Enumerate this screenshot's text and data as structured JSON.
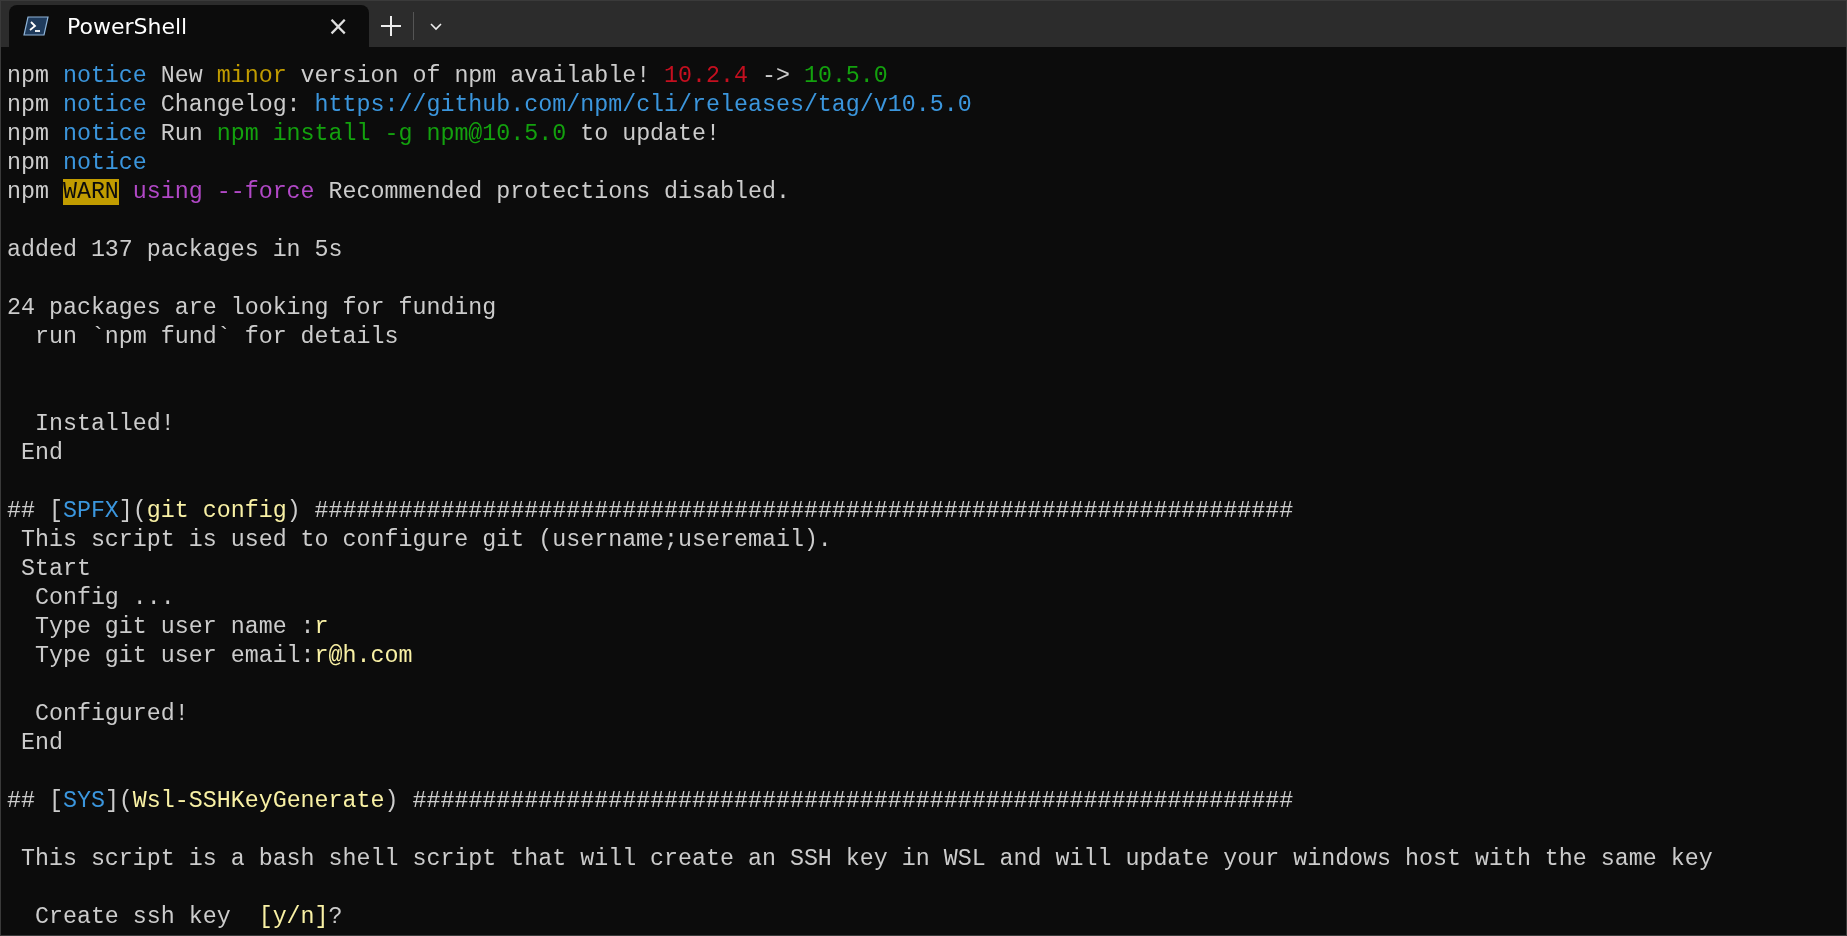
{
  "tab": {
    "title": "PowerShell",
    "selected": true
  },
  "lines": [
    {
      "kind": "text",
      "segments": [
        {
          "text": "npm ",
          "color": "#cccccc"
        },
        {
          "text": "notice",
          "color": "#3b96dd"
        },
        {
          "text": " New ",
          "color": "#cccccc"
        },
        {
          "text": "minor",
          "color": "#c19c00"
        },
        {
          "text": " version of npm available! ",
          "color": "#cccccc"
        },
        {
          "text": "10.2.4",
          "color": "#c50f1f"
        },
        {
          "text": " -> ",
          "color": "#cccccc"
        },
        {
          "text": "10.5.0",
          "color": "#13a10e"
        }
      ]
    },
    {
      "kind": "text",
      "segments": [
        {
          "text": "npm ",
          "color": "#cccccc"
        },
        {
          "text": "notice",
          "color": "#3b96dd"
        },
        {
          "text": " Changelog: ",
          "color": "#cccccc"
        },
        {
          "text": "https://github.com/npm/cli/releases/tag/v10.5.0",
          "color": "#3b96dd"
        }
      ]
    },
    {
      "kind": "text",
      "segments": [
        {
          "text": "npm ",
          "color": "#cccccc"
        },
        {
          "text": "notice",
          "color": "#3b96dd"
        },
        {
          "text": " Run ",
          "color": "#cccccc"
        },
        {
          "text": "npm install -g npm@10.5.0",
          "color": "#13a10e"
        },
        {
          "text": " to update!",
          "color": "#cccccc"
        }
      ]
    },
    {
      "kind": "text",
      "segments": [
        {
          "text": "npm ",
          "color": "#cccccc"
        },
        {
          "text": "notice",
          "color": "#3b96dd"
        }
      ]
    },
    {
      "kind": "text",
      "segments": [
        {
          "text": "npm ",
          "color": "#cccccc"
        },
        {
          "text": "WARN",
          "color": "#c19c00",
          "kind": "badge"
        },
        {
          "text": " using --force",
          "color": "#b148c6"
        },
        {
          "text": " Recommended protections disabled.",
          "color": "#cccccc"
        }
      ]
    },
    {
      "kind": "blank"
    },
    {
      "kind": "text",
      "segments": [
        {
          "text": "added 137 packages in 5s",
          "color": "#cccccc"
        }
      ]
    },
    {
      "kind": "blank"
    },
    {
      "kind": "text",
      "segments": [
        {
          "text": "24 packages are looking for funding",
          "color": "#cccccc"
        }
      ]
    },
    {
      "kind": "text",
      "segments": [
        {
          "text": "  run `npm fund` for details",
          "color": "#cccccc"
        }
      ]
    },
    {
      "kind": "blank"
    },
    {
      "kind": "blank"
    },
    {
      "kind": "text",
      "segments": [
        {
          "text": "  Installed!",
          "color": "#cccccc"
        }
      ]
    },
    {
      "kind": "text",
      "segments": [
        {
          "text": " End",
          "color": "#cccccc"
        }
      ]
    },
    {
      "kind": "blank"
    },
    {
      "kind": "text",
      "segments": [
        {
          "text": "## [",
          "color": "#cccccc"
        },
        {
          "text": "SPFX",
          "color": "#3b96dd"
        },
        {
          "text": "](",
          "color": "#cccccc"
        },
        {
          "text": "git config",
          "color": "#f9f1a5"
        },
        {
          "text": ") ######################################################################",
          "color": "#cccccc"
        }
      ]
    },
    {
      "kind": "text",
      "segments": [
        {
          "text": " This script is used to configure git (username;useremail).",
          "color": "#cccccc"
        }
      ]
    },
    {
      "kind": "text",
      "segments": [
        {
          "text": " Start",
          "color": "#cccccc"
        }
      ]
    },
    {
      "kind": "text",
      "segments": [
        {
          "text": "  Config ...",
          "color": "#cccccc"
        }
      ]
    },
    {
      "kind": "text",
      "segments": [
        {
          "text": "  Type git user name :",
          "color": "#cccccc"
        },
        {
          "text": "r",
          "color": "#f9f1a5"
        }
      ]
    },
    {
      "kind": "text",
      "segments": [
        {
          "text": "  Type git user email:",
          "color": "#cccccc"
        },
        {
          "text": "r@h.com",
          "color": "#f9f1a5"
        }
      ]
    },
    {
      "kind": "blank"
    },
    {
      "kind": "text",
      "segments": [
        {
          "text": "  Configured!",
          "color": "#cccccc"
        }
      ]
    },
    {
      "kind": "text",
      "segments": [
        {
          "text": " End",
          "color": "#cccccc"
        }
      ]
    },
    {
      "kind": "blank"
    },
    {
      "kind": "text",
      "segments": [
        {
          "text": "## [",
          "color": "#cccccc"
        },
        {
          "text": "SYS",
          "color": "#3b96dd"
        },
        {
          "text": "](",
          "color": "#cccccc"
        },
        {
          "text": "Wsl-SSHKeyGenerate",
          "color": "#f9f1a5"
        },
        {
          "text": ") ###############################################################",
          "color": "#cccccc"
        }
      ]
    },
    {
      "kind": "blank"
    },
    {
      "kind": "text",
      "segments": [
        {
          "text": " This script is a bash shell script that will create an SSH key in WSL and will update your windows host with the same key",
          "color": "#cccccc"
        }
      ]
    },
    {
      "kind": "blank"
    },
    {
      "kind": "text",
      "segments": [
        {
          "text": "  Create ssh key  ",
          "color": "#cccccc"
        },
        {
          "text": "[y/n]",
          "color": "#f9f1a5"
        },
        {
          "text": "?",
          "color": "#cccccc"
        }
      ]
    }
  ],
  "tab_close": "×"
}
